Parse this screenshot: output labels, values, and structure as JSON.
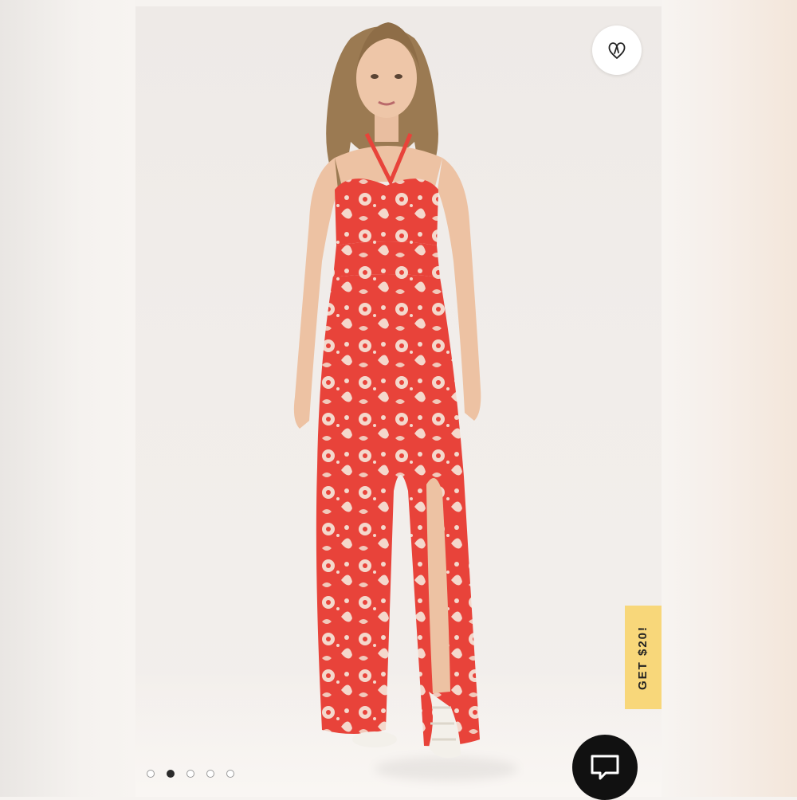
{
  "product_gallery": {
    "promo_tab": {
      "label": "GET $20!"
    },
    "wishlist": {
      "icon": "heart-icon"
    },
    "chat": {
      "icon": "chat-icon"
    },
    "carousel": {
      "total": 5,
      "active_index": 1
    }
  }
}
